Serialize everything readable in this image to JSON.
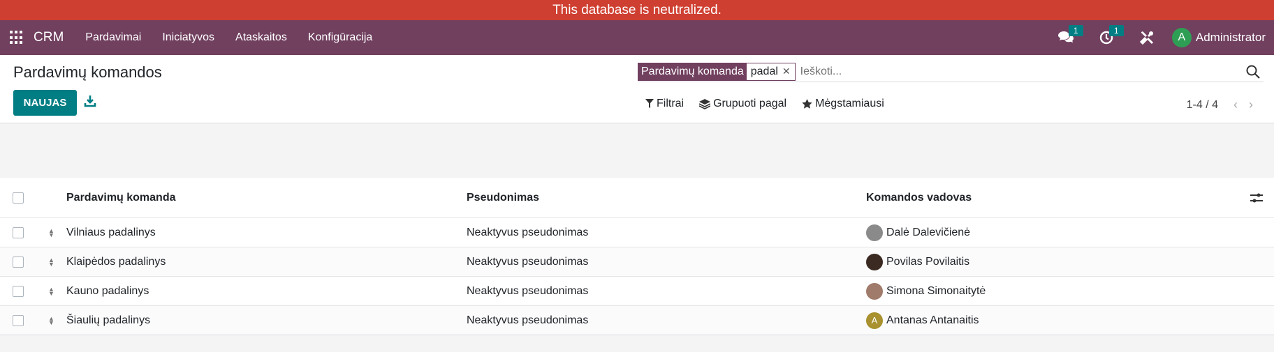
{
  "banner": {
    "text": "This database is neutralized."
  },
  "navbar": {
    "apps_icon": "apps-grid-icon",
    "brand": "CRM",
    "menu": [
      "Pardavimai",
      "Iniciatyvos",
      "Ataskaitos",
      "Konfigūracija"
    ],
    "messages_badge": "1",
    "activities_badge": "1",
    "user_initial": "A",
    "user_name": "Administrator"
  },
  "control": {
    "title": "Pardavimų komandos",
    "new_label": "NAUJAS",
    "search": {
      "facet_label": "Pardavimų komanda",
      "facet_value": "padal",
      "placeholder": "Ieškoti..."
    },
    "filters": [
      "Filtrai",
      "Grupuoti pagal",
      "Mėgstamiausi"
    ],
    "pager": "1-4 / 4"
  },
  "table": {
    "headers": [
      "Pardavimų komanda",
      "Pseudonimas",
      "Komandos vadovas"
    ],
    "rows": [
      {
        "team": "Vilniaus padalinys",
        "alias": "Neaktyvus pseudonimas",
        "leader": "Dalė Dalevičienė",
        "avatar_color": "#8a8a8a",
        "initial": ""
      },
      {
        "team": "Klaipėdos padalinys",
        "alias": "Neaktyvus pseudonimas",
        "leader": "Povilas Povilaitis",
        "avatar_color": "#3a2a22",
        "initial": ""
      },
      {
        "team": "Kauno padalinys",
        "alias": "Neaktyvus pseudonimas",
        "leader": "Simona Simonaitytė",
        "avatar_color": "#a07a6a",
        "initial": ""
      },
      {
        "team": "Šiaulių padalinys",
        "alias": "Neaktyvus pseudonimas",
        "leader": "Antanas Antanaitis",
        "avatar_color": "#a8912e",
        "initial": "A"
      }
    ]
  },
  "colors": {
    "brand": "#71405f",
    "primary": "#017e84",
    "banner": "#cf3f31"
  }
}
